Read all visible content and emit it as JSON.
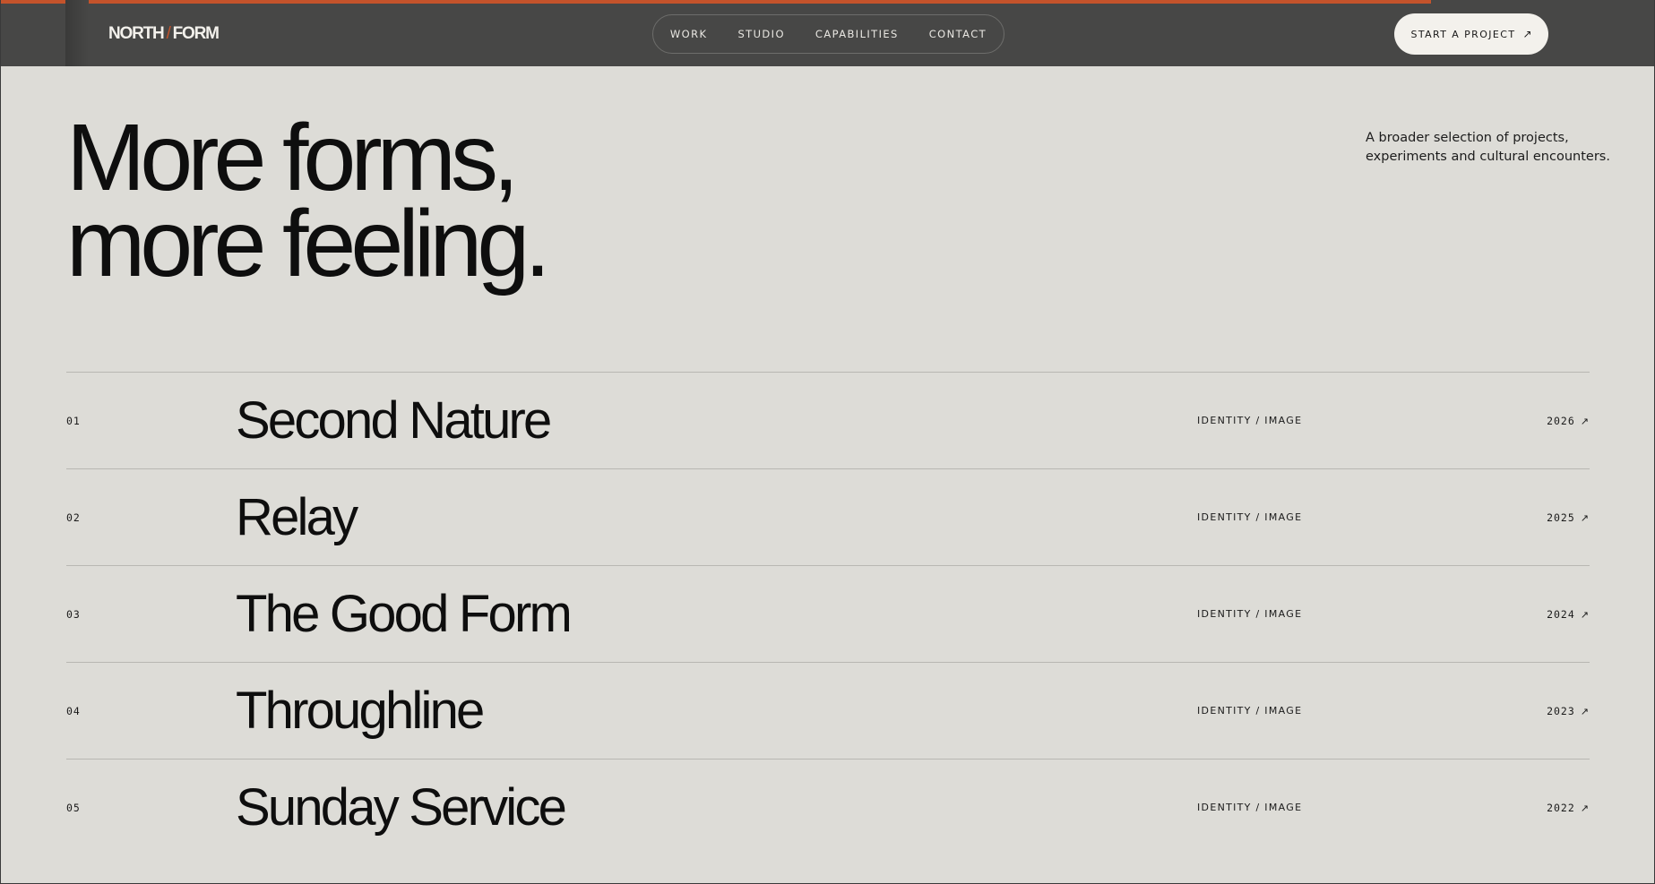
{
  "colors": {
    "header_bg": "#474746",
    "page_bg": "#dddcd7",
    "accent": "#c4532b",
    "cta_bg": "#f3f1ec",
    "text": "#0e0e0e"
  },
  "scroll_progress": 0.865,
  "header": {
    "logo": {
      "left": "NORTH",
      "slash": "/",
      "right": "FORM"
    },
    "nav": [
      {
        "label": "WORK"
      },
      {
        "label": "STUDIO"
      },
      {
        "label": "CAPABILITIES"
      },
      {
        "label": "CONTACT"
      }
    ],
    "cta": {
      "label": "START A PROJECT",
      "icon": "arrow-up-right-icon",
      "glyph": "↗"
    }
  },
  "hero": {
    "title_line_1": "More forms,",
    "title_line_2": "more feeling.",
    "description_line_1": "A broader selection of projects,",
    "description_line_2": "experiments and cultural encounters."
  },
  "projects": [
    {
      "index": "01",
      "title": "Second Nature",
      "tags": "IDENTITY / IMAGE",
      "year": "2026",
      "glyph": "↗"
    },
    {
      "index": "02",
      "title": "Relay",
      "tags": "IDENTITY / IMAGE",
      "year": "2025",
      "glyph": "↗"
    },
    {
      "index": "03",
      "title": "The Good Form",
      "tags": "IDENTITY / IMAGE",
      "year": "2024",
      "glyph": "↗"
    },
    {
      "index": "04",
      "title": "Throughline",
      "tags": "IDENTITY / IMAGE",
      "year": "2023",
      "glyph": "↗"
    },
    {
      "index": "05",
      "title": "Sunday Service",
      "tags": "IDENTITY / IMAGE",
      "year": "2022",
      "glyph": "↗"
    }
  ]
}
